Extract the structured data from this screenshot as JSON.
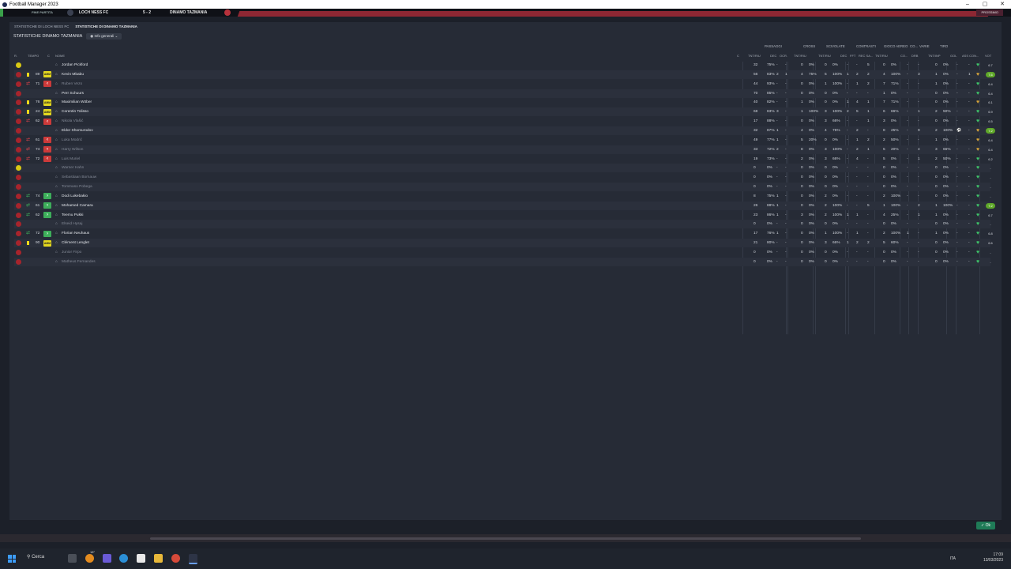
{
  "window": {
    "title": "Football Manager 2023",
    "controls": [
      "–",
      "▢",
      "✕"
    ]
  },
  "match_bar": {
    "label_left": "FINE PARTITA",
    "home_team": "LOCH NESS FC",
    "score": "5 - 2",
    "away_team": "DINAMO TAZMANIA",
    "right_label": "PROSSIMO"
  },
  "tabs": [
    {
      "label": "STATISTICHE DI LOCH NESS FC"
    },
    {
      "label": "STATISTICHE DI DINAMO TAZMANIA"
    }
  ],
  "section": {
    "title": "STATISTICHE DINAMO TAZMANIA",
    "view_label": "Info generali"
  },
  "groups": [
    "PASSAGGI",
    "CROSS",
    "SCIVOLATE",
    "CONTRASTI",
    "GIOCO AEREO",
    "CO...",
    "VARIE",
    "TIRO"
  ],
  "columns": {
    "ruolo": "R.",
    "tempo": "TEMPO",
    "c": "C",
    "nome": "NOME",
    "cond": "C",
    "pass_tnt": "TNT/RIU",
    "pass_dec": "DEC",
    "pass_occ": "OCR.",
    "cross_tnt": "TNT/RIU",
    "sciv_tnt": "TNT/RIU",
    "contr_dec": "DEC",
    "contr_fft": "FFT",
    "contr_rec": "REC SA...",
    "aereo_tnt": "TNT/RIU",
    "co": "CO...",
    "dri": "DRB",
    "tiro_tnt": "TNT/INP",
    "gol": "GOL",
    "ass": "ASS CON...",
    "voto": "VOT"
  },
  "players": [
    {
      "name": "Jordan Pickford",
      "pos": "gk",
      "min": "",
      "sub": "",
      "pass": "32",
      "pass_pct": "75%",
      "dec": "-",
      "occ": "-",
      "cross": "0",
      "cross_pct": "0%",
      "sciv": "0",
      "sciv_pct": "0%",
      "cd": "-",
      "cf": "-",
      "cr": "5",
      "aer": "0",
      "aer_pct": "0%",
      "co": "-",
      "dri": "-",
      "tiro": "0",
      "tiro_pct": "0%",
      "gol": "-",
      "ass": "-",
      "rating": "6.7",
      "hi": false
    },
    {
      "name": "Kevin Mbabu",
      "pos": "out",
      "min": "89",
      "sub": "amm",
      "pass": "56",
      "pass_pct": "83%",
      "dec": "2",
      "occ": "1",
      "cross": "4",
      "cross_pct": "75%",
      "sciv": "5",
      "sciv_pct": "100%",
      "cd": "1",
      "cf": "2",
      "cr": "2",
      "aer": "4",
      "aer_pct": "100%",
      "co": "-",
      "dri": "3",
      "tiro": "1",
      "tiro_pct": "0%",
      "gol": "-",
      "ass": "1",
      "rating": "7.6",
      "hi": true
    },
    {
      "name": "Ruben Vezo",
      "pos": "out",
      "min": "71",
      "sub": "off",
      "pass": "44",
      "pass_pct": "93%",
      "dec": "-",
      "occ": "-",
      "cross": "0",
      "cross_pct": "0%",
      "sciv": "1",
      "sciv_pct": "100%",
      "cd": "-",
      "cf": "1",
      "cr": "2",
      "aer": "7",
      "aer_pct": "71%",
      "co": "-",
      "dri": "-",
      "tiro": "1",
      "tiro_pct": "0%",
      "gol": "-",
      "ass": "-",
      "rating": "6.4",
      "hi": false
    },
    {
      "name": "Perr Schuurs",
      "pos": "out",
      "min": "",
      "sub": "",
      "pass": "70",
      "pass_pct": "85%",
      "dec": "-",
      "occ": "-",
      "cross": "0",
      "cross_pct": "0%",
      "sciv": "0",
      "sciv_pct": "0%",
      "cd": "-",
      "cf": "-",
      "cr": "-",
      "aer": "1",
      "aer_pct": "0%",
      "co": "-",
      "dri": "-",
      "tiro": "0",
      "tiro_pct": "0%",
      "gol": "-",
      "ass": "-",
      "rating": "6.4",
      "hi": false
    },
    {
      "name": "Maximilian Wöber",
      "pos": "out",
      "min": "76",
      "sub": "amm",
      "pass": "40",
      "pass_pct": "82%",
      "dec": "-",
      "occ": "-",
      "cross": "1",
      "cross_pct": "0%",
      "sciv": "0",
      "sciv_pct": "0%",
      "cd": "1",
      "cf": "4",
      "cr": "1",
      "aer": "7",
      "aer_pct": "71%",
      "co": "-",
      "dri": "-",
      "tiro": "0",
      "tiro_pct": "0%",
      "gol": "-",
      "ass": "-",
      "rating": "6.1",
      "hi": false
    },
    {
      "name": "Corentin Tolisso",
      "pos": "out",
      "min": "24",
      "sub": "amm",
      "pass": "68",
      "pass_pct": "83%",
      "dec": "3",
      "occ": "-",
      "cross": "1",
      "cross_pct": "100%",
      "sciv": "3",
      "sciv_pct": "100%",
      "cd": "2",
      "cf": "5",
      "cr": "1",
      "aer": "6",
      "aer_pct": "66%",
      "co": "-",
      "dri": "1",
      "tiro": "2",
      "tiro_pct": "50%",
      "gol": "-",
      "ass": "-",
      "rating": "6.9",
      "hi": false
    },
    {
      "name": "Nikola Vlašić",
      "pos": "out",
      "min": "62",
      "sub": "off",
      "pass": "17",
      "pass_pct": "88%",
      "dec": "-",
      "occ": "-",
      "cross": "0",
      "cross_pct": "0%",
      "sciv": "3",
      "sciv_pct": "66%",
      "cd": "-",
      "cf": "-",
      "cr": "1",
      "aer": "3",
      "aer_pct": "0%",
      "co": "-",
      "dri": "-",
      "tiro": "0",
      "tiro_pct": "0%",
      "gol": "-",
      "ass": "-",
      "rating": "6.5",
      "hi": false
    },
    {
      "name": "Eldor Shomurodov",
      "pos": "out",
      "min": "",
      "sub": "",
      "pass": "32",
      "pass_pct": "87%",
      "dec": "1",
      "occ": "-",
      "cross": "4",
      "cross_pct": "0%",
      "sciv": "4",
      "sciv_pct": "75%",
      "cd": "-",
      "cf": "2",
      "cr": "-",
      "aer": "8",
      "aer_pct": "25%",
      "co": "-",
      "dri": "9",
      "tiro": "2",
      "tiro_pct": "100%",
      "gol": "⚽",
      "ass": "-",
      "rating": "7.2",
      "hi": true
    },
    {
      "name": "Luka Modrić",
      "pos": "out",
      "min": "61",
      "sub": "off",
      "pass": "49",
      "pass_pct": "77%",
      "dec": "1",
      "occ": "-",
      "cross": "5",
      "cross_pct": "20%",
      "sciv": "0",
      "sciv_pct": "0%",
      "cd": "-",
      "cf": "1",
      "cr": "2",
      "aer": "2",
      "aer_pct": "50%",
      "co": "-",
      "dri": "-",
      "tiro": "1",
      "tiro_pct": "0%",
      "gol": "-",
      "ass": "-",
      "rating": "6.4",
      "hi": false
    },
    {
      "name": "Harry Wilson",
      "pos": "out",
      "min": "74",
      "sub": "off",
      "pass": "33",
      "pass_pct": "72%",
      "dec": "2",
      "occ": "-",
      "cross": "8",
      "cross_pct": "0%",
      "sciv": "3",
      "sciv_pct": "100%",
      "cd": "-",
      "cf": "2",
      "cr": "1",
      "aer": "5",
      "aer_pct": "20%",
      "co": "-",
      "dri": "4",
      "tiro": "3",
      "tiro_pct": "66%",
      "gol": "-",
      "ass": "-",
      "rating": "6.4",
      "hi": false
    },
    {
      "name": "Luis Muriel",
      "pos": "out",
      "min": "72",
      "sub": "off",
      "pass": "19",
      "pass_pct": "73%",
      "dec": "-",
      "occ": "-",
      "cross": "2",
      "cross_pct": "0%",
      "sciv": "3",
      "sciv_pct": "66%",
      "cd": "-",
      "cf": "4",
      "cr": "-",
      "aer": "5",
      "aer_pct": "0%",
      "co": "-",
      "dri": "1",
      "tiro": "2",
      "tiro_pct": "50%",
      "gol": "-",
      "ass": "-",
      "rating": "6.2",
      "hi": false
    },
    {
      "name": "Warner Hahn",
      "pos": "gk",
      "min": "",
      "sub": "",
      "pass": "0",
      "pass_pct": "0%",
      "dec": "-",
      "occ": "-",
      "cross": "0",
      "cross_pct": "0%",
      "sciv": "0",
      "sciv_pct": "0%",
      "cd": "-",
      "cf": "-",
      "cr": "-",
      "aer": "0",
      "aer_pct": "0%",
      "co": "-",
      "dri": "-",
      "tiro": "0",
      "tiro_pct": "0%",
      "gol": "-",
      "ass": "-",
      "rating": "-",
      "hi": false
    },
    {
      "name": "Sebastiaan Bornauw",
      "pos": "out",
      "min": "",
      "sub": "",
      "pass": "0",
      "pass_pct": "0%",
      "dec": "-",
      "occ": "-",
      "cross": "0",
      "cross_pct": "0%",
      "sciv": "0",
      "sciv_pct": "0%",
      "cd": "-",
      "cf": "-",
      "cr": "-",
      "aer": "0",
      "aer_pct": "0%",
      "co": "-",
      "dri": "-",
      "tiro": "0",
      "tiro_pct": "0%",
      "gol": "-",
      "ass": "-",
      "rating": "-",
      "hi": false
    },
    {
      "name": "Tommaso Pobega",
      "pos": "out",
      "min": "",
      "sub": "",
      "pass": "0",
      "pass_pct": "0%",
      "dec": "-",
      "occ": "-",
      "cross": "0",
      "cross_pct": "0%",
      "sciv": "0",
      "sciv_pct": "0%",
      "cd": "-",
      "cf": "-",
      "cr": "-",
      "aer": "0",
      "aer_pct": "0%",
      "co": "-",
      "dri": "-",
      "tiro": "0",
      "tiro_pct": "0%",
      "gol": "-",
      "ass": "-",
      "rating": "-",
      "hi": false
    },
    {
      "name": "Dodi Lukebakio",
      "pos": "out",
      "min": "74",
      "sub": "on",
      "pass": "8",
      "pass_pct": "75%",
      "dec": "1",
      "occ": "-",
      "cross": "0",
      "cross_pct": "0%",
      "sciv": "2",
      "sciv_pct": "0%",
      "cd": "-",
      "cf": "-",
      "cr": "-",
      "aer": "2",
      "aer_pct": "100%",
      "co": "-",
      "dri": "-",
      "tiro": "0",
      "tiro_pct": "0%",
      "gol": "-",
      "ass": "-",
      "rating": "-",
      "hi": false
    },
    {
      "name": "Mohamed Camara",
      "pos": "out",
      "min": "61",
      "sub": "on",
      "pass": "26",
      "pass_pct": "88%",
      "dec": "1",
      "occ": "-",
      "cross": "0",
      "cross_pct": "0%",
      "sciv": "2",
      "sciv_pct": "100%",
      "cd": "-",
      "cf": "-",
      "cr": "5",
      "aer": "1",
      "aer_pct": "100%",
      "co": "-",
      "dri": "2",
      "tiro": "1",
      "tiro_pct": "100%",
      "gol": "-",
      "ass": "-",
      "rating": "7.2",
      "hi": true
    },
    {
      "name": "Teemu Pukki",
      "pos": "out",
      "min": "62",
      "sub": "on",
      "pass": "23",
      "pass_pct": "86%",
      "dec": "1",
      "occ": "-",
      "cross": "3",
      "cross_pct": "0%",
      "sciv": "2",
      "sciv_pct": "100%",
      "cd": "1",
      "cf": "1",
      "cr": "-",
      "aer": "4",
      "aer_pct": "25%",
      "co": "-",
      "dri": "1",
      "tiro": "1",
      "tiro_pct": "0%",
      "gol": "-",
      "ass": "-",
      "rating": "6.7",
      "hi": false
    },
    {
      "name": "Elseid Hysaj",
      "pos": "out",
      "min": "",
      "sub": "",
      "pass": "0",
      "pass_pct": "0%",
      "dec": "-",
      "occ": "-",
      "cross": "0",
      "cross_pct": "0%",
      "sciv": "0",
      "sciv_pct": "0%",
      "cd": "-",
      "cf": "-",
      "cr": "-",
      "aer": "0",
      "aer_pct": "0%",
      "co": "-",
      "dri": "-",
      "tiro": "0",
      "tiro_pct": "0%",
      "gol": "-",
      "ass": "-",
      "rating": "-",
      "hi": false
    },
    {
      "name": "Florian Neuhaus",
      "pos": "out",
      "min": "72",
      "sub": "on",
      "pass": "17",
      "pass_pct": "76%",
      "dec": "1",
      "occ": "-",
      "cross": "0",
      "cross_pct": "0%",
      "sciv": "1",
      "sciv_pct": "100%",
      "cd": "-",
      "cf": "1",
      "cr": "-",
      "aer": "2",
      "aer_pct": "100%",
      "co": "1",
      "dri": "-",
      "tiro": "1",
      "tiro_pct": "0%",
      "gol": "-",
      "ass": "-",
      "rating": "6.8",
      "hi": false
    },
    {
      "name": "Clément Lenglet",
      "pos": "out",
      "min": "90",
      "sub": "amm",
      "pass": "21",
      "pass_pct": "80%",
      "dec": "-",
      "occ": "-",
      "cross": "0",
      "cross_pct": "0%",
      "sciv": "3",
      "sciv_pct": "66%",
      "cd": "1",
      "cf": "2",
      "cr": "2",
      "aer": "5",
      "aer_pct": "60%",
      "co": "-",
      "dri": "-",
      "tiro": "0",
      "tiro_pct": "0%",
      "gol": "-",
      "ass": "-",
      "rating": "6.6",
      "hi": false
    },
    {
      "name": "Junior Firpo",
      "pos": "out",
      "min": "",
      "sub": "",
      "pass": "0",
      "pass_pct": "0%",
      "dec": "-",
      "occ": "-",
      "cross": "0",
      "cross_pct": "0%",
      "sciv": "0",
      "sciv_pct": "0%",
      "cd": "-",
      "cf": "-",
      "cr": "-",
      "aer": "0",
      "aer_pct": "0%",
      "co": "-",
      "dri": "-",
      "tiro": "0",
      "tiro_pct": "0%",
      "gol": "-",
      "ass": "-",
      "rating": "-",
      "hi": false
    },
    {
      "name": "Matheus Fernandes",
      "pos": "out",
      "min": "",
      "sub": "",
      "pass": "0",
      "pass_pct": "0%",
      "dec": "-",
      "occ": "-",
      "cross": "0",
      "cross_pct": "0%",
      "sciv": "0",
      "sciv_pct": "0%",
      "cd": "-",
      "cf": "-",
      "cr": "-",
      "aer": "0",
      "aer_pct": "0%",
      "co": "-",
      "dri": "-",
      "tiro": "0",
      "tiro_pct": "0%",
      "gol": "-",
      "ass": "-",
      "rating": "-",
      "hi": false
    }
  ],
  "ok_button": "✓ Ok",
  "taskbar": {
    "search": "Cerca",
    "temp": "18°",
    "lang": "ITA",
    "time": "17:09",
    "date": "13/03/2023"
  },
  "colors": {
    "accent": "#1f7b57",
    "red": "#a7242c",
    "yellow": "#e4d81f"
  }
}
